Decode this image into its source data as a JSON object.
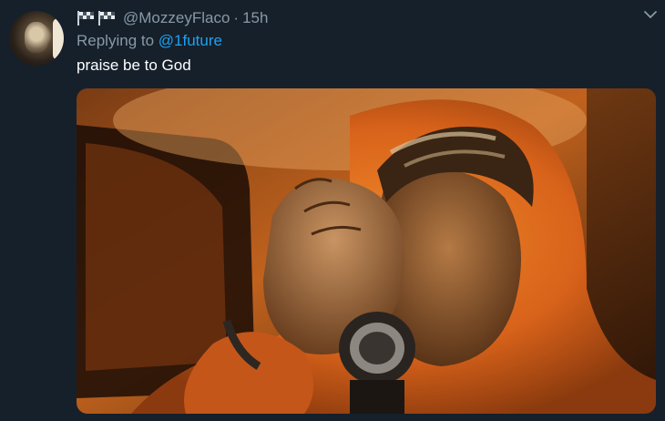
{
  "tweet": {
    "handle": "@MozzeyFlaco",
    "separator": "·",
    "time": "15h",
    "replying_prefix": "Replying to",
    "replying_to": "@1future",
    "text": "praise be to God"
  },
  "icons": {
    "flags": [
      "chequered-flag-icon",
      "chequered-flag-icon"
    ],
    "menu": "chevron-down-icon"
  },
  "colors": {
    "background": "#15202b",
    "secondary_text": "#8899a6",
    "link": "#1da1f2",
    "primary_text": "#ffffff"
  },
  "media": {
    "subject": "man in orange hoodie praying with clasped hands, wearing wristwatch"
  }
}
